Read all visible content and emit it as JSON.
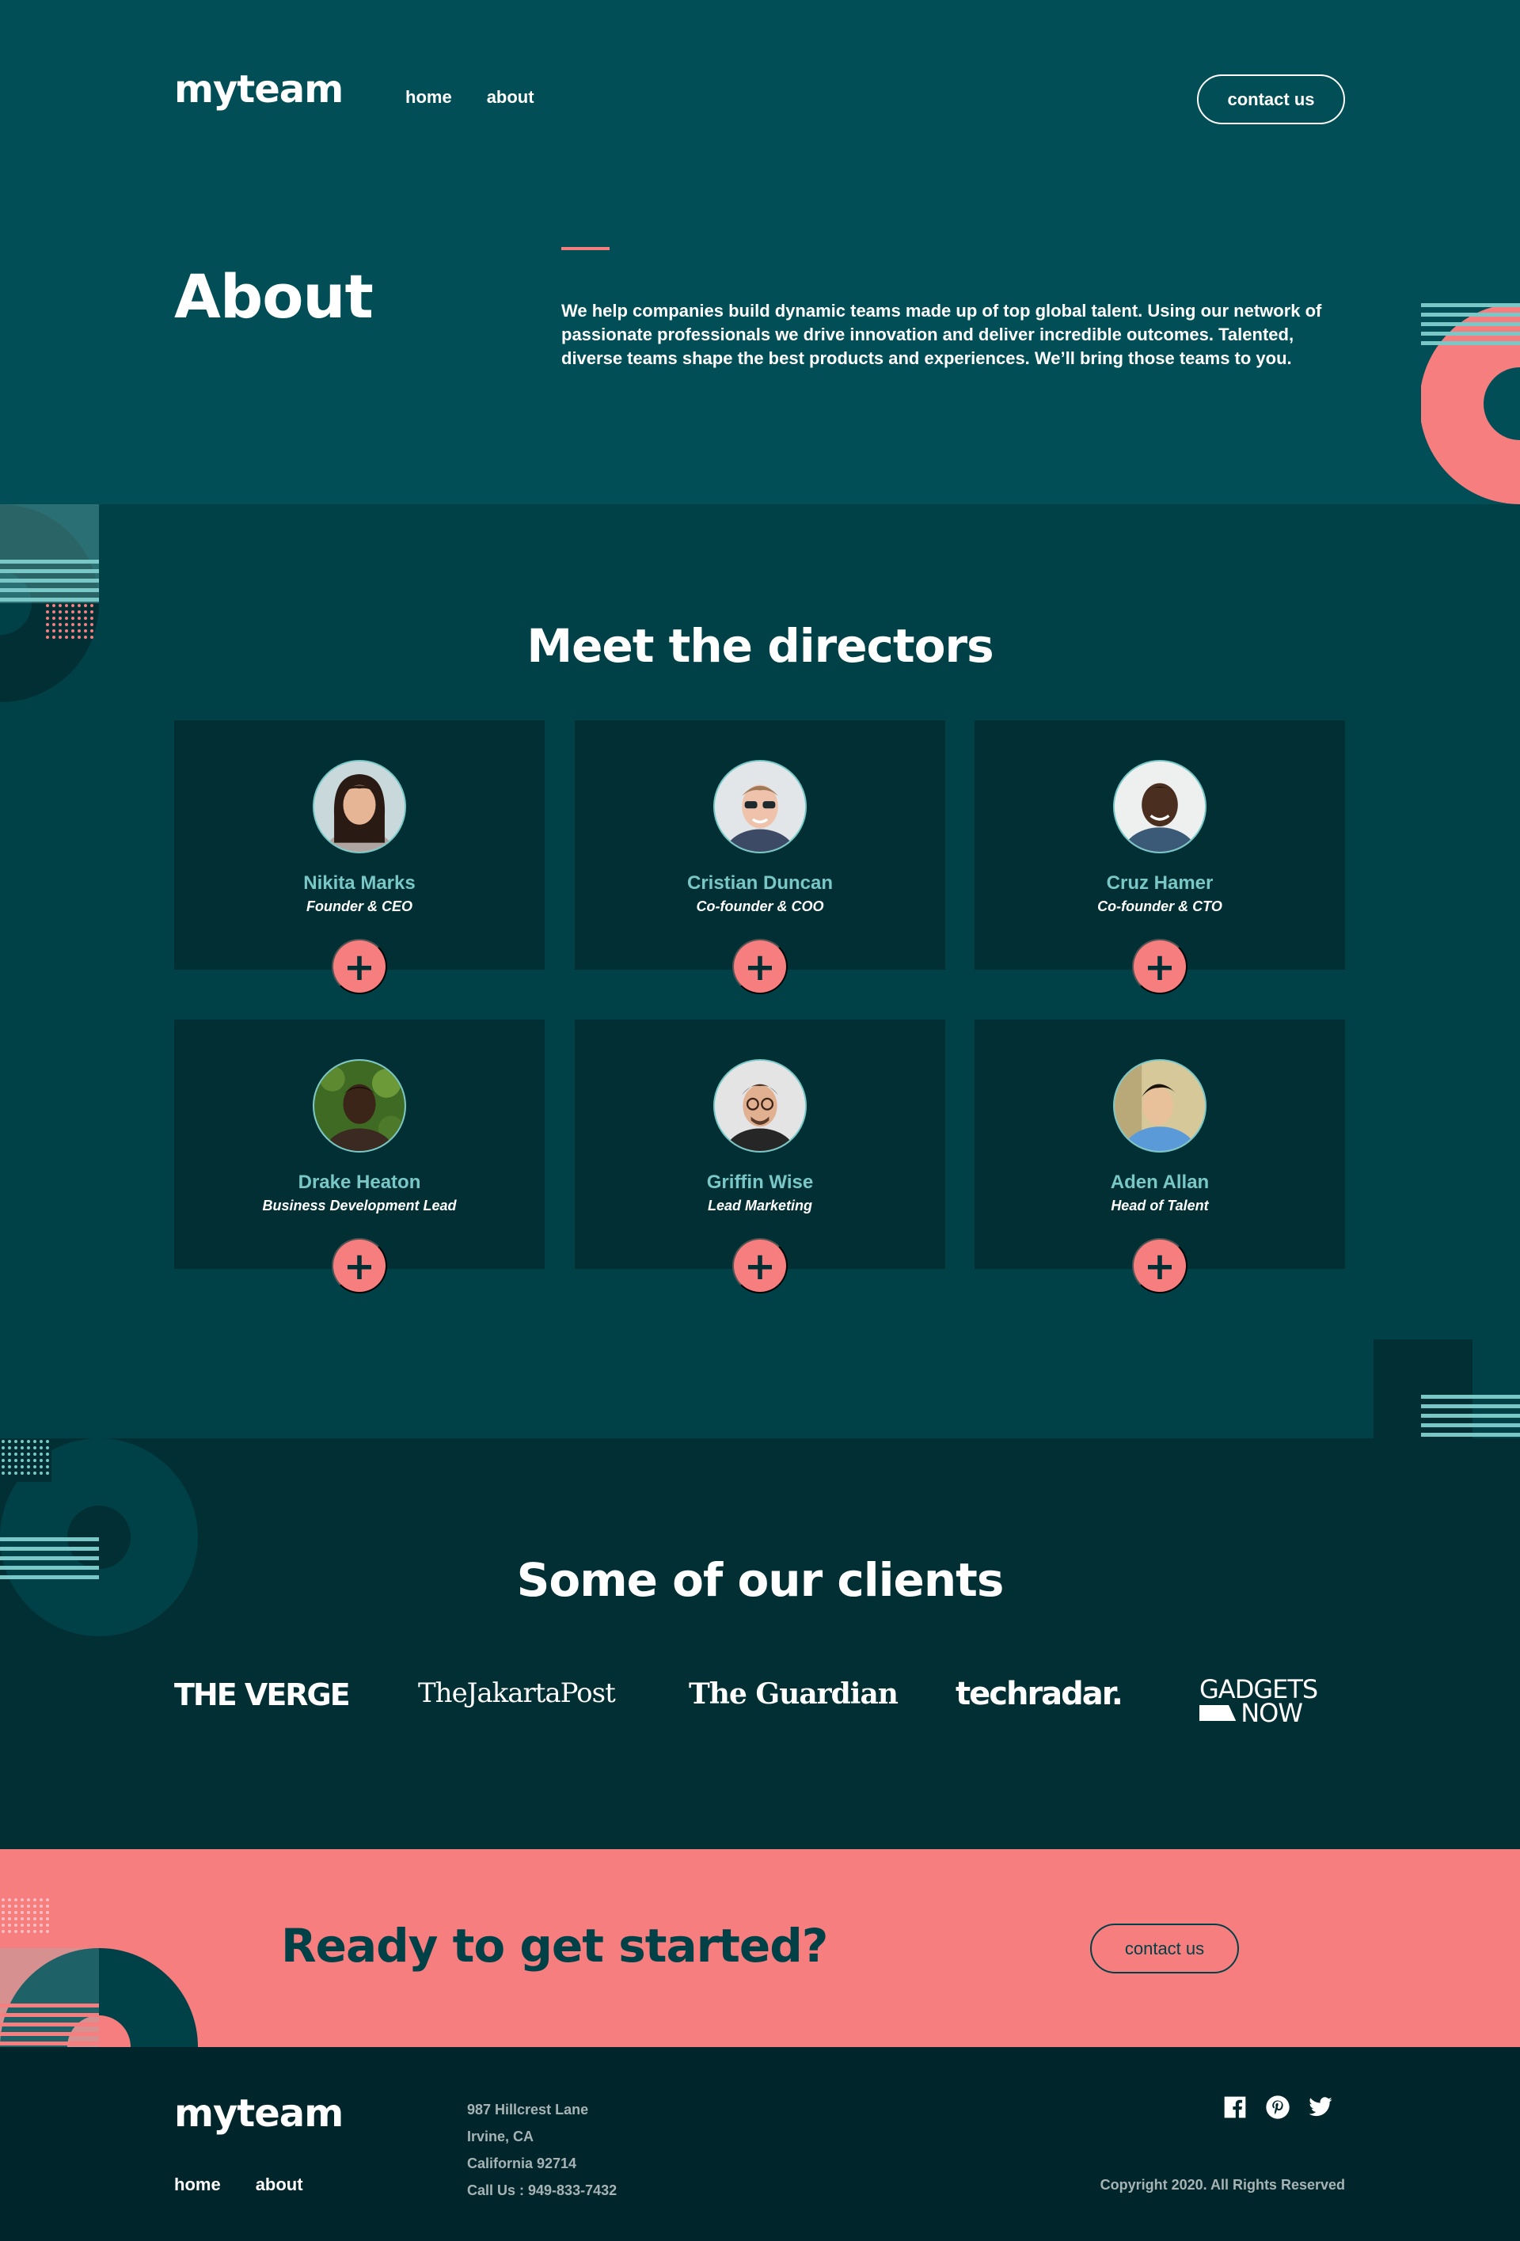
{
  "header": {
    "logo": "myteam",
    "nav": [
      "home",
      "about"
    ],
    "contact_button": "contact us"
  },
  "about": {
    "title": "About",
    "text": "We help companies build dynamic teams made up of top global talent. Using our network of passionate professionals we drive innovation and deliver incredible outcomes. Talented, diverse teams shape the best products and experiences. We’ll bring those teams to you."
  },
  "directors": {
    "title": "Meet the directors",
    "people": [
      {
        "name": "Nikita Marks",
        "role": "Founder & CEO"
      },
      {
        "name": "Cristian Duncan",
        "role": "Co-founder & COO"
      },
      {
        "name": "Cruz Hamer",
        "role": "Co-founder & CTO"
      },
      {
        "name": "Drake Heaton",
        "role": "Business Development Lead"
      },
      {
        "name": "Griffin Wise",
        "role": "Lead Marketing"
      },
      {
        "name": "Aden Allan",
        "role": "Head of Talent"
      }
    ],
    "expand_symbol": "+"
  },
  "clients": {
    "title": "Some of our clients",
    "logos": [
      "THE VERGE",
      "TheJakartaPost",
      "The Guardian",
      "techradar.",
      "GADGETS",
      "NOW"
    ]
  },
  "cta": {
    "title": "Ready to get started?",
    "button": "contact us"
  },
  "footer": {
    "logo": "myteam",
    "nav": [
      "home",
      "about"
    ],
    "address": [
      "987 Hillcrest Lane",
      "Irvine, CA",
      "California 92714",
      "Call Us : 949-833-7432"
    ],
    "socials": [
      "facebook-icon",
      "pinterest-icon",
      "twitter-icon"
    ],
    "copyright": "Copyright 2020. All Rights Reserved"
  },
  "colors": {
    "primary_dark": "#014e56",
    "section_dark": "#004047",
    "darker": "#012f34",
    "darkest": "#00252a",
    "coral": "#f67e7e",
    "mint": "#79c8c7"
  }
}
